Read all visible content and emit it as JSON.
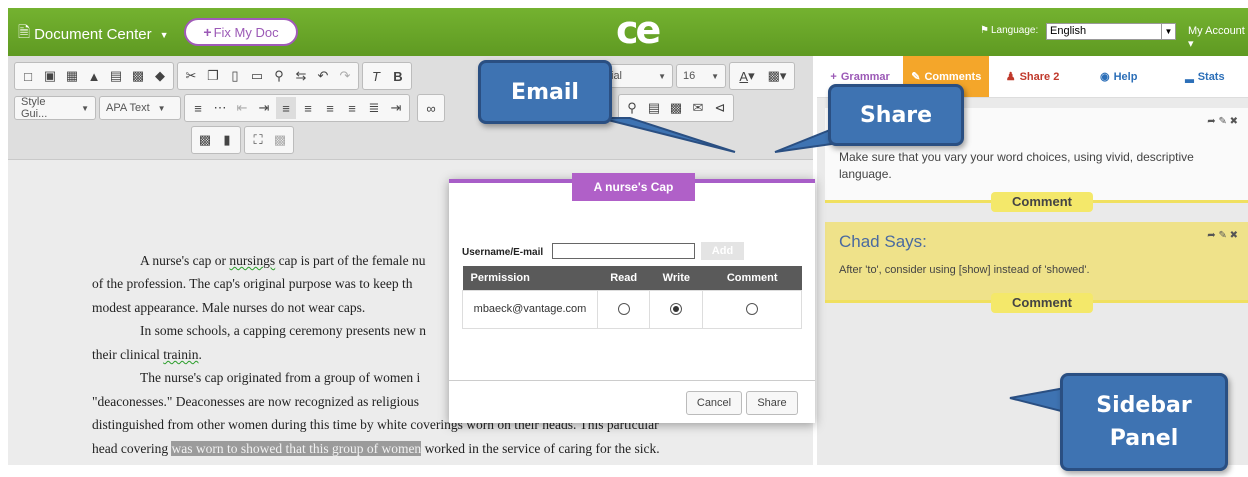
{
  "topbar": {
    "doc_center": "Document Center",
    "fix_my_doc": "Fix My Doc",
    "logo": "ce",
    "language_label": "Language:",
    "language_value": "English",
    "account": "My Account"
  },
  "toolbar": {
    "font_name": "Arial",
    "font_size": "16",
    "style_guide": "Style Gui...",
    "apa_text": "APA Text"
  },
  "tabs": {
    "grammar": "Grammar",
    "comments": "Comments",
    "share": "Share 2",
    "help": "Help",
    "stats": "Stats"
  },
  "sidebar": {
    "card1_text_line1": "Make sure that you vary your word choices, using vivid, descriptive",
    "card1_text_line2": "language.",
    "comment_label": "Comment",
    "card2_title": "Chad Says:",
    "card2_text": "After 'to', consider using [show] instead of 'showed'."
  },
  "document": {
    "p1a": "A nurse's cap or ",
    "p1b": "nursings",
    "p1c": " cap is part of the female nu",
    "p2": "of the profession. The cap's original purpose was to keep th",
    "p3": "modest appearance. Male nurses do not wear caps.",
    "p4": "In some schools, a capping ceremony presents new n",
    "p5a": "their clinical ",
    "p5b": "trainin",
    "p5c": ".",
    "p6": "The nurse's cap originated from a group of women i",
    "p7": "\"deaconesses.\" Deaconesses are now recognized as religious",
    "p8": "distinguished from other women during this time by white coverings worn on their heads. This particular",
    "p9a": "head covering ",
    "p9b": "was worn to showed that this group of women",
    "p9c": " worked in the service of caring for the sick."
  },
  "modal": {
    "title": "A nurse's Cap",
    "username_label": "Username/E-mail",
    "add_label": "Add",
    "columns": [
      "Permission",
      "Read",
      "Write",
      "Comment"
    ],
    "rows": [
      {
        "email": "mbaeck@vantage.com",
        "read": false,
        "write": true,
        "comment": false
      }
    ],
    "cancel": "Cancel",
    "share": "Share"
  },
  "callouts": {
    "email": "Email",
    "share": "Share",
    "sidebar_line1": "Sidebar",
    "sidebar_line2": "Panel"
  },
  "colors": {
    "topbar_green": "#6aa428",
    "modal_purple": "#b060c8",
    "comments_orange": "#f4a62a",
    "callout_blue": "#3e73b2",
    "comment_yellow": "#f4e86a"
  }
}
